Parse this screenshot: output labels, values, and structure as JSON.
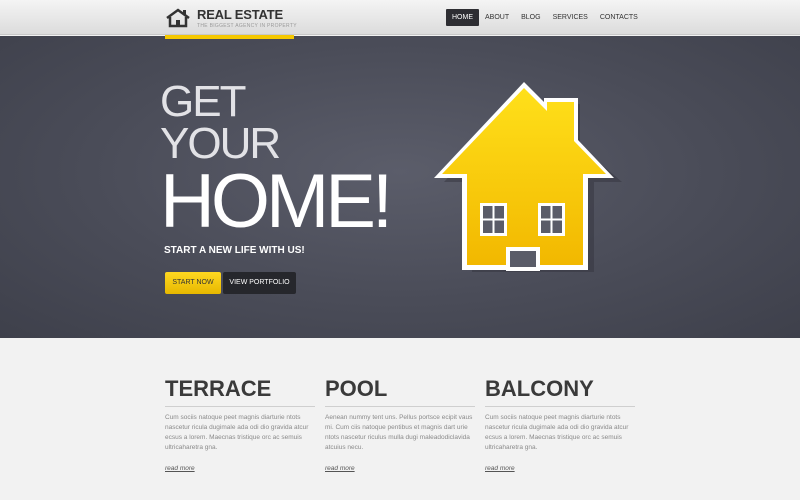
{
  "header": {
    "logo_title": "REAL ESTATE",
    "logo_tagline": "THE BIGGEST AGENCY IN PROPERTY",
    "logo_icon": "house-icon"
  },
  "nav": {
    "items": [
      "HOME",
      "ABOUT",
      "BLOG",
      "SERVICES",
      "CONTACTS"
    ],
    "active": "HOME"
  },
  "hero": {
    "line1": "GET",
    "line2": "YOUR",
    "line3": "HOME!",
    "subtitle": "START A NEW LIFE WITH US!",
    "start_button": "START NOW",
    "portfolio_button": "VIEW PORTFOLIO",
    "illustration": "house-illustration"
  },
  "features": [
    {
      "title": "TERRACE",
      "text": "Cum sociis natoque peet magnis diarturie ntots nascetur ricula dugimale ada odi dio gravida atcur ecsus a lorem. Maecnas tristique orc ac semuis ultricaharetra gna.",
      "link": "read more"
    },
    {
      "title": "POOL",
      "text": "Aenean nummy tent uns. Pellus portsce ecipit vaus mi. Cum ciis natoque pentibus et magnis dart urie ntots nascetur riculus mulla dugi maleadodiclavida atcuius necu.",
      "link": "read more"
    },
    {
      "title": "BALCONY",
      "text": "Cum sociis natoque peet magnis diarturie ntots nascetur ricula dugimale ada odi dio gravida atcur ecsus a lorem. Maecnas tristique orc ac semuis ultricaharetra gna.",
      "link": "read more"
    }
  ],
  "colors": {
    "accent": "#f5c800",
    "hero_bg": "#4a4c58",
    "nav_active": "#2e2e33"
  }
}
